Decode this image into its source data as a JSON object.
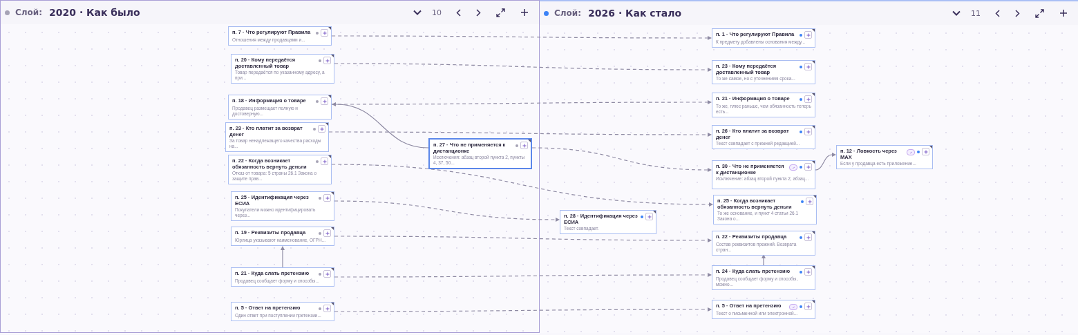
{
  "layers": [
    {
      "label": "Слой:",
      "title": "2020 · Как было",
      "count": "10",
      "color": "#a6a3b5",
      "selected": true,
      "nodes": [
        {
          "title": "п. 7 · Что регулируют Правила",
          "text": "Отношения между продавцами и...",
          "linked": false,
          "selected": false
        },
        {
          "title": "п. 20 · Кому передаётся доставленный товар",
          "text": "Товар передаётся по указанному адресу, а при...",
          "linked": false,
          "selected": false
        },
        {
          "title": "п. 18 · Информация о товаре",
          "text": "Продавец размещает полную и достоверную...",
          "linked": false,
          "selected": false
        },
        {
          "title": "п. 23 · Кто платит за возврат денег",
          "text": "За товар ненадлежащего качества расходы на...",
          "linked": false,
          "selected": false
        },
        {
          "title": "п. 22 · Когда возникает обязанность вернуть деньги",
          "text": "Отказ от товара: 5 страны 26.1 Закона о защите прав...",
          "linked": false,
          "selected": false
        },
        {
          "title": "п. 25 · Идентификация через ЕСИА",
          "text": "Покупатели можно идентифицировать через...",
          "linked": false,
          "selected": false
        },
        {
          "title": "п. 19 · Реквизиты продавца",
          "text": "Юрлица указывают наименование, ОГРН...",
          "linked": false,
          "selected": false
        },
        {
          "title": "п. 21 · Куда слать претензию",
          "text": "Продавец сообщает форму и способы...",
          "linked": false,
          "selected": false
        },
        {
          "title": "п. 5 · Ответ на претензию",
          "text": "Один ответ при поступлении претензии...",
          "linked": false,
          "selected": false
        },
        {
          "title": "п. 27 · Что не применяется к дистанционке",
          "text": "Исключения: абзац второй пункта 2, пункты 4, 37, 50...",
          "linked": false,
          "selected": true
        }
      ]
    },
    {
      "label": "Слой:",
      "title": "2026 · Как стало",
      "count": "11",
      "color": "#3b82f6",
      "selected": false,
      "nodes": [
        {
          "title": "п. 1 · Что регулируют Правила",
          "text": "К предмету добавлены основания между...",
          "linked": false,
          "selected": false
        },
        {
          "title": "п. 23 · Кому передаётся доставленный товар",
          "text": "То же самое, но с уточнением срока...",
          "linked": false,
          "selected": false
        },
        {
          "title": "п. 21 · Информация о товаре",
          "text": "То же, плюс раньше, чем обязанность теперь есть...",
          "linked": false,
          "selected": false
        },
        {
          "title": "п. 26 · Кто платит за возврат денег",
          "text": "Текст совпадает с прежней редакцией...",
          "linked": false,
          "selected": false
        },
        {
          "title": "п. 30 · Что не применяется к дистанционке",
          "text": "Исключение: абзац второй пункта 2, абзац...",
          "linked": true,
          "selected": false
        },
        {
          "title": "п. 12 · Ловкость через MAX",
          "text": "Если у продавца есть приложение...",
          "linked": true,
          "selected": false
        },
        {
          "title": "п. 25 · Когда возникает обязанность вернуть деньги",
          "text": "То же основание, и пункт 4 статьи 26.1 Закона о...",
          "linked": false,
          "selected": false
        },
        {
          "title": "п. 28 · Идентификация через ЕСИА",
          "text": "Текст совпадает.",
          "linked": false,
          "selected": false
        },
        {
          "title": "п. 22 · Реквизиты продавца",
          "text": "Состав реквизитов прежний. Возврата стран...",
          "linked": false,
          "selected": false
        },
        {
          "title": "п. 24 · Куда слать претензию",
          "text": "Продавец сообщает форму и способы, можно...",
          "linked": false,
          "selected": false
        },
        {
          "title": "п. 5 · Ответ на претензию",
          "text": "Текст о письменной или электронной...",
          "linked": true,
          "selected": false
        }
      ]
    }
  ]
}
